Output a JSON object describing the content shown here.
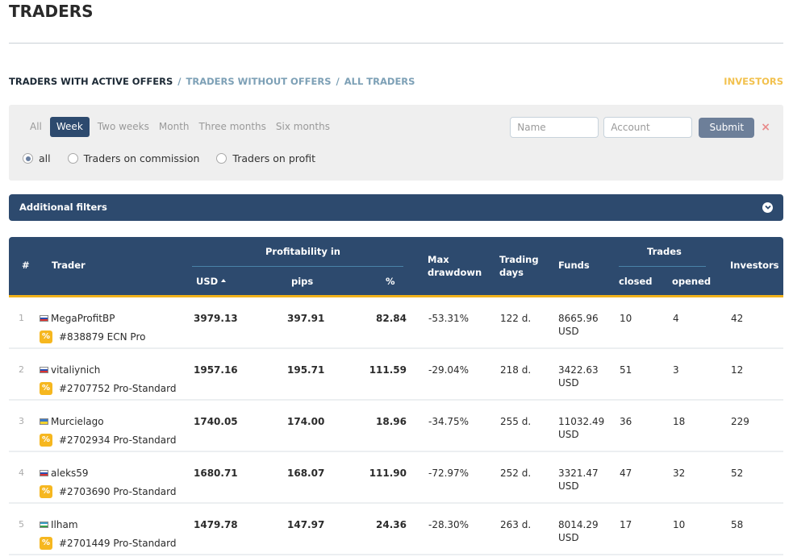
{
  "page": {
    "title": "TRADERS"
  },
  "nav": {
    "tabs": [
      {
        "label": "TRADERS WITH ACTIVE OFFERS",
        "active": true
      },
      {
        "label": "TRADERS WITHOUT OFFERS",
        "active": false
      },
      {
        "label": "ALL TRADERS",
        "active": false
      }
    ],
    "separator": "/",
    "investors_link": "INVESTORS"
  },
  "filters": {
    "periods": [
      {
        "label": "All",
        "active": false
      },
      {
        "label": "Week",
        "active": true
      },
      {
        "label": "Two weeks",
        "active": false
      },
      {
        "label": "Month",
        "active": false
      },
      {
        "label": "Three months",
        "active": false
      },
      {
        "label": "Six months",
        "active": false
      }
    ],
    "radios": [
      {
        "label": "all",
        "checked": true
      },
      {
        "label": "Traders on commission",
        "checked": false
      },
      {
        "label": "Traders on profit",
        "checked": false
      }
    ],
    "name_placeholder": "Name",
    "name_value": "",
    "account_placeholder": "Account",
    "account_value": "",
    "submit_label": "Submit",
    "clear_icon": "×",
    "additional_filters_label": "Additional filters"
  },
  "table": {
    "headers": {
      "rank": "#",
      "trader": "Trader",
      "profitability_group": "Profitability in",
      "usd": "USD",
      "pips": "pips",
      "percent": "%",
      "max_drawdown_line1": "Max",
      "max_drawdown_line2": "drawdown",
      "trading_days_line1": "Trading",
      "trading_days_line2": "days",
      "funds": "Funds",
      "trades_group": "Trades",
      "closed": "closed",
      "opened": "opened",
      "investors": "Investors"
    },
    "sort": {
      "column": "USD",
      "direction": "desc-arrow-up-icon"
    },
    "badge_text": "%",
    "rows": [
      {
        "rank": "1",
        "flag": "ru",
        "name": "MegaProfitBP",
        "account": "#838879 ECN Pro",
        "usd": "3979.13",
        "pips": "397.91",
        "percent": "82.84",
        "max_drawdown": "-53.31%",
        "trading_days": "122 d.",
        "funds": "8665.96",
        "funds_currency": "USD",
        "closed": "10",
        "opened": "4",
        "investors": "42"
      },
      {
        "rank": "2",
        "flag": "ru",
        "name": "vitaliynich",
        "account": "#2707752 Pro-Standard",
        "usd": "1957.16",
        "pips": "195.71",
        "percent": "111.59",
        "max_drawdown": "-29.04%",
        "trading_days": "218 d.",
        "funds": "3422.63",
        "funds_currency": "USD",
        "closed": "51",
        "opened": "3",
        "investors": "12"
      },
      {
        "rank": "3",
        "flag": "ua",
        "name": "Murcielago",
        "account": "#2702934 Pro-Standard",
        "usd": "1740.05",
        "pips": "174.00",
        "percent": "18.96",
        "max_drawdown": "-34.75%",
        "trading_days": "255 d.",
        "funds": "11032.49",
        "funds_currency": "USD",
        "closed": "36",
        "opened": "18",
        "investors": "229"
      },
      {
        "rank": "4",
        "flag": "ru",
        "name": "aleks59",
        "account": "#2703690 Pro-Standard",
        "usd": "1680.71",
        "pips": "168.07",
        "percent": "111.90",
        "max_drawdown": "-72.97%",
        "trading_days": "252 d.",
        "funds": "3321.47",
        "funds_currency": "USD",
        "closed": "47",
        "opened": "32",
        "investors": "52"
      },
      {
        "rank": "5",
        "flag": "uz",
        "name": "Ilham",
        "account": "#2701449 Pro-Standard",
        "usd": "1479.78",
        "pips": "147.97",
        "percent": "24.36",
        "max_drawdown": "-28.30%",
        "trading_days": "263 d.",
        "funds": "8014.29",
        "funds_currency": "USD",
        "closed": "17",
        "opened": "10",
        "investors": "58"
      }
    ]
  }
}
